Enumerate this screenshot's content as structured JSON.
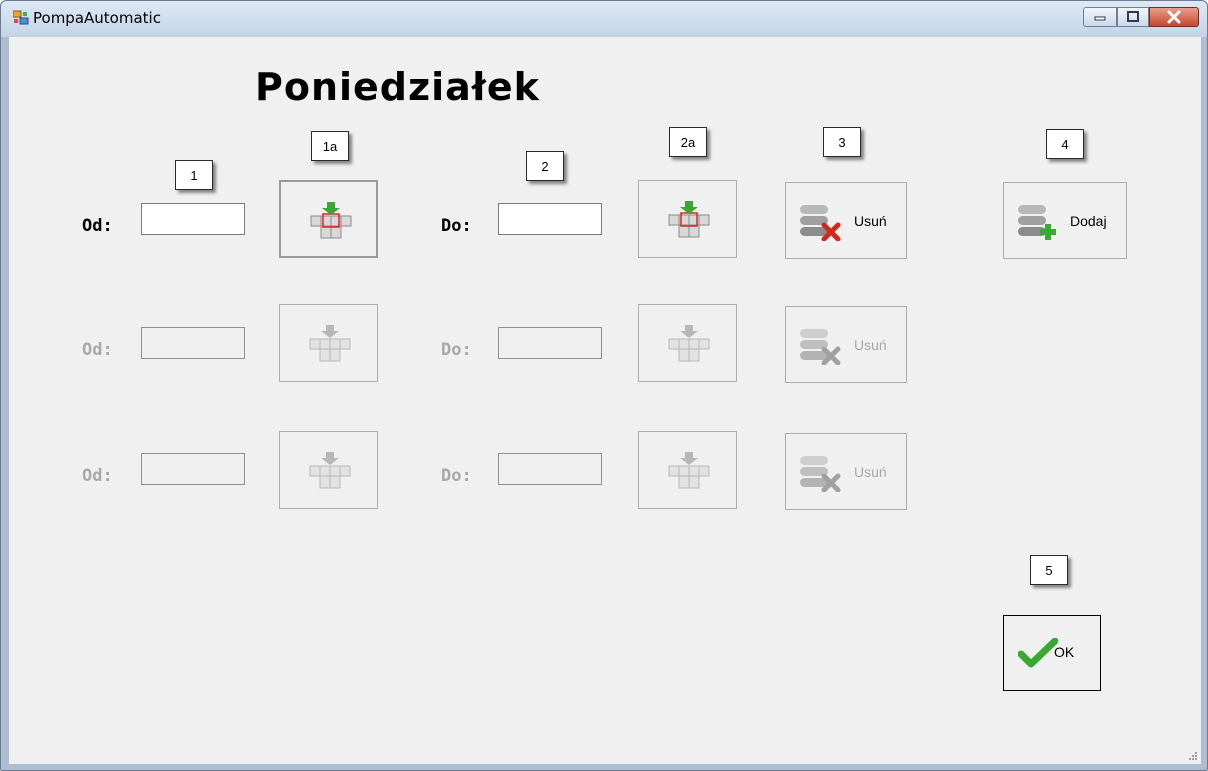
{
  "window": {
    "title": "PompaAutomatic",
    "controls": {
      "minimize": "minimize",
      "maximize": "maximize",
      "close": "close"
    }
  },
  "heading": "Poniedziałek",
  "labels": {
    "from": "Od:",
    "to": "Do:"
  },
  "rows": [
    {
      "enabled": true,
      "from_value": "",
      "to_value": "",
      "delete_label": "Usuń"
    },
    {
      "enabled": false,
      "from_value": "",
      "to_value": "",
      "delete_label": "Usuń"
    },
    {
      "enabled": false,
      "from_value": "",
      "to_value": "",
      "delete_label": "Usuń"
    }
  ],
  "add_button": {
    "label": "Dodaj"
  },
  "ok_button": {
    "label": "OK"
  },
  "callouts": {
    "c1": "1",
    "c1a": "1a",
    "c2": "2",
    "c2a": "2a",
    "c3": "3",
    "c4": "4",
    "c5": "5"
  },
  "icons": {
    "app": "app-window-icon",
    "keyboard": "keyboard-insert-icon",
    "delete": "database-delete-icon",
    "add": "database-add-icon",
    "ok": "checkmark-icon"
  },
  "colors": {
    "accent_green": "#3aa832",
    "delete_red": "#d12a1a",
    "window_frame": "#aebed2"
  }
}
